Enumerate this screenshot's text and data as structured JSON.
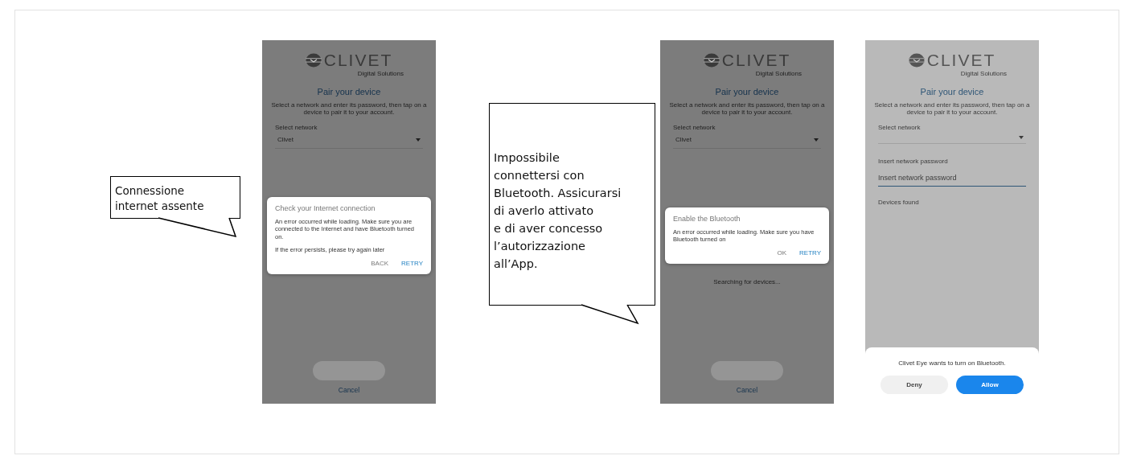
{
  "callouts": [
    {
      "lines": [
        "Connessione",
        "internet assente"
      ]
    },
    {
      "lines": [
        "Impossibile",
        "connettersi con",
        "Bluetooth. Assicurarsi",
        "di averlo attivato",
        "e di aver concesso",
        "l’autorizzazione",
        "all’App."
      ]
    }
  ],
  "screens": [
    {
      "kind": "dialog",
      "logo": "CLIVET",
      "tagline": "Digital Solutions",
      "title": "Pair your device",
      "description": "Select a network and enter its password, then tap on a device to pair it to your account.",
      "network_label": "Select network",
      "network_value": "Clivet",
      "cancel": "Cancel",
      "dialog": {
        "title": "Check your Internet connection",
        "paragraphs": [
          "An error occurred while loading. Make sure you are connected to the Internet and have Bluetooth turned on.",
          "If the error persists, please try again later"
        ],
        "buttons": [
          {
            "label": "BACK",
            "primary": false
          },
          {
            "label": "RETRY",
            "primary": true
          }
        ]
      }
    },
    {
      "kind": "dialog",
      "logo": "CLIVET",
      "tagline": "Digital Solutions",
      "title": "Pair your device",
      "description": "Select a network and enter its password, then tap on a device to pair it to your account.",
      "network_label": "Select network",
      "network_value": "Clivet",
      "status": "Searching for devices...",
      "cancel": "Cancel",
      "dialog": {
        "title": "Enable the Bluetooth",
        "paragraphs": [
          "An error occurred while loading. Make sure you have Bluetooth turned on"
        ],
        "buttons": [
          {
            "label": "OK",
            "primary": false
          },
          {
            "label": "RETRY",
            "primary": true
          }
        ]
      }
    },
    {
      "kind": "sheet",
      "logo": "CLIVET",
      "tagline": "Digital Solutions",
      "title": "Pair your device",
      "description": "Select a network and enter its password, then tap on a device to pair it to your account.",
      "network_label": "Select network",
      "password_label": "Insert network password",
      "password_placeholder": "Insert network password",
      "devices_label": "Devices found",
      "sheet": {
        "message": "Clivet Eye wants to turn on Bluetooth.",
        "buttons": [
          {
            "label": "Deny",
            "primary": false
          },
          {
            "label": "Allow",
            "primary": true
          }
        ]
      }
    }
  ]
}
